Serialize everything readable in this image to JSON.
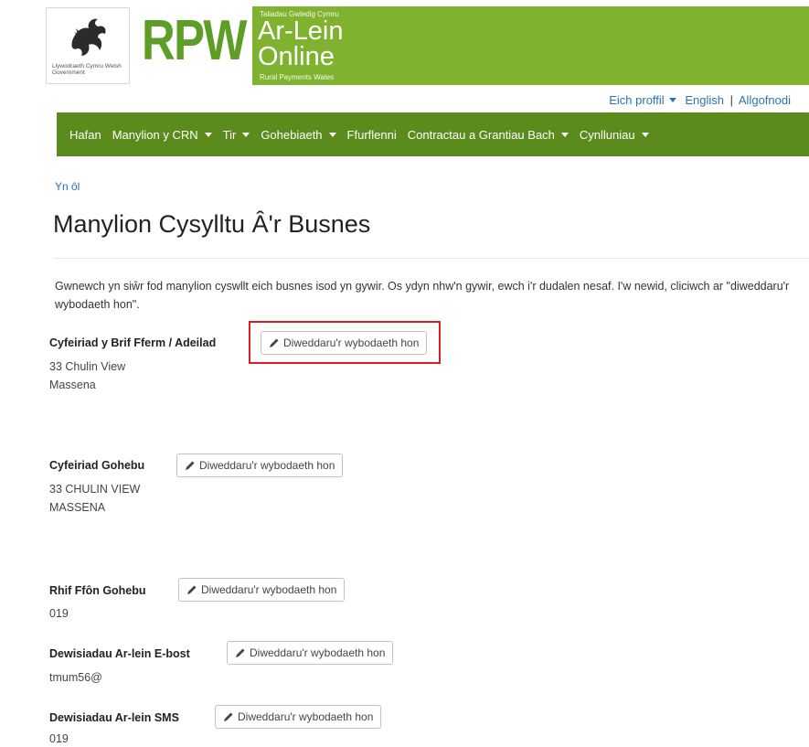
{
  "header": {
    "wg_logo_text": "Llywodraeth Cymru Welsh Government",
    "rpw_mark": "RPW",
    "banner_small": "Taliadau Gwledig Cymru",
    "banner_line1": "Ar-Lein",
    "banner_line2": "Online",
    "banner_sub": "Rural Payments Wales"
  },
  "utility": {
    "profile": "Eich proffil",
    "language": "English",
    "separator": "|",
    "logout": "Allgofnodi"
  },
  "nav": {
    "items": [
      {
        "label": "Hafan",
        "dropdown": false
      },
      {
        "label": "Manylion y CRN",
        "dropdown": true
      },
      {
        "label": "Tir",
        "dropdown": true
      },
      {
        "label": "Gohebiaeth",
        "dropdown": true
      },
      {
        "label": "Ffurflenni",
        "dropdown": false
      },
      {
        "label": "Contractau a Grantiau Bach",
        "dropdown": true
      },
      {
        "label": "Cynlluniau",
        "dropdown": true
      }
    ]
  },
  "page": {
    "back": "Yn ôl",
    "title": "Manylion Cysylltu Â'r Busnes",
    "intro": "Gwnewch yn siŵr fod manylion cyswllt eich busnes isod yn gywir. Os ydyn nhw'n gywir, ewch i'r dudalen nesaf. I'w newid, cliciwch ar \"diweddaru'r wybodaeth hon\"."
  },
  "sections": [
    {
      "label": "Cyfeiriad y Brif Fferm / Adeilad",
      "button": "Diweddaru'r wybodaeth hon",
      "lines": [
        "33 Chulin View",
        "Massena"
      ],
      "highlighted": true
    },
    {
      "label": "Cyfeiriad Gohebu",
      "button": "Diweddaru'r wybodaeth hon",
      "lines": [
        "33 CHULIN VIEW",
        "MASSENA"
      ]
    },
    {
      "label": "Rhif Ffôn Gohebu",
      "button": "Diweddaru'r wybodaeth hon",
      "lines": [
        "019"
      ]
    },
    {
      "label": "Dewisiadau Ar-lein E-bost",
      "button": "Diweddaru'r wybodaeth hon",
      "lines": [
        "tmum56@"
      ]
    },
    {
      "label": "Dewisiadau Ar-lein SMS",
      "button": "Diweddaru'r wybodaeth hon",
      "lines": [
        "019"
      ]
    }
  ],
  "colors": {
    "banner_green": "#7fb32f",
    "nav_green": "#5b8b1c",
    "link_blue": "#2a73b8",
    "highlight_red": "#d71f26"
  }
}
